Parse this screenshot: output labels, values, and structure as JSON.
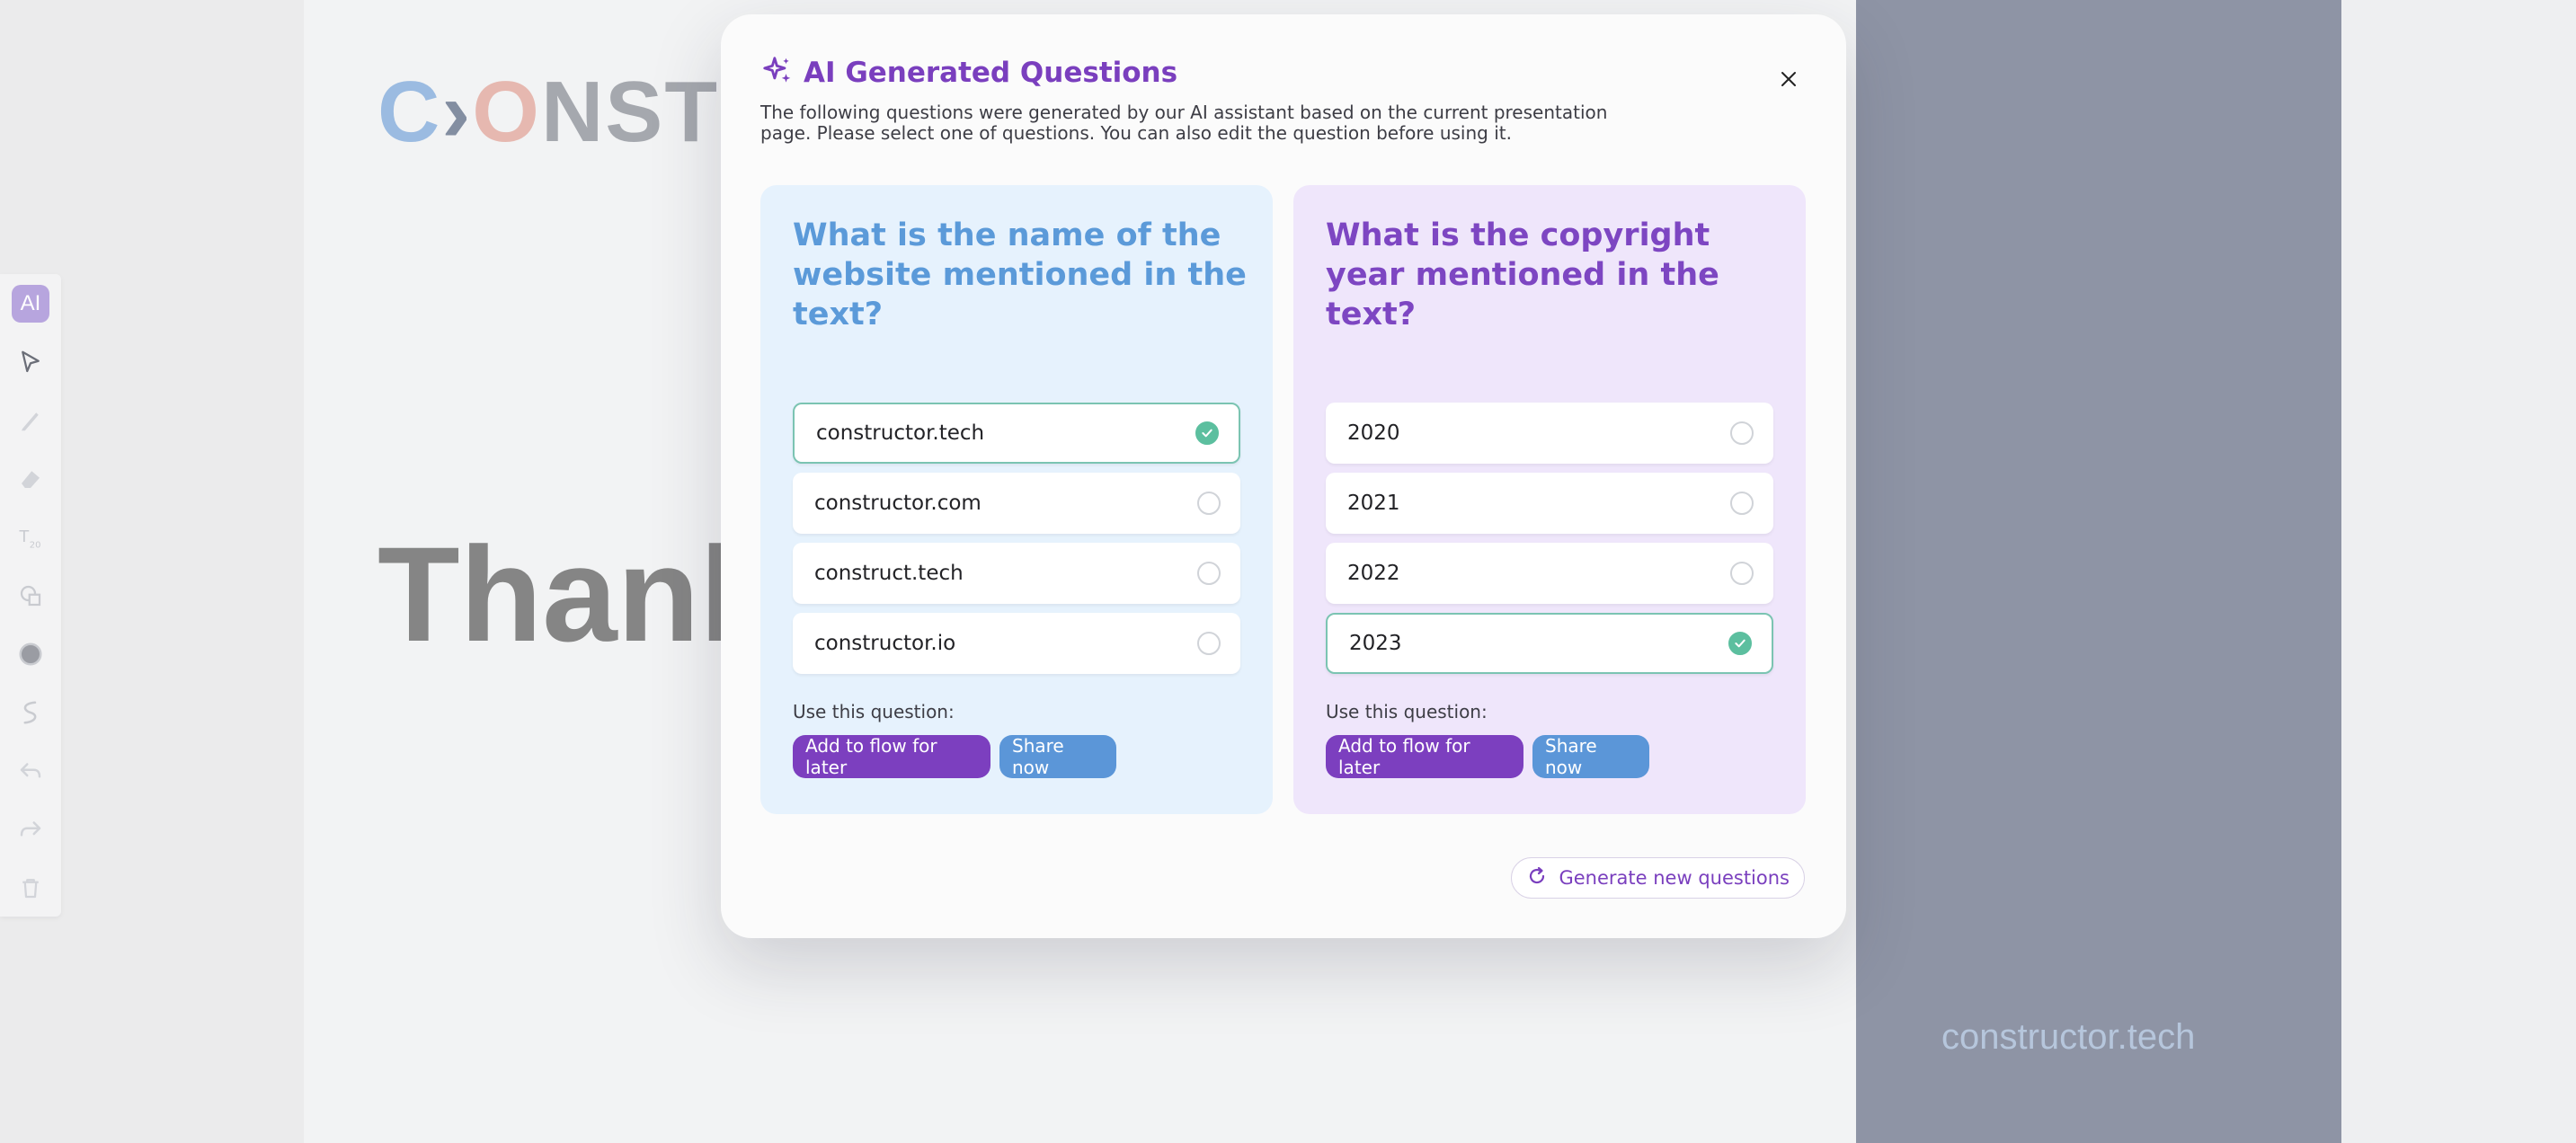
{
  "slide": {
    "logo": {
      "c": "C",
      "arrow": "›",
      "o": "O",
      "rest": "NST"
    },
    "heading": "Thank",
    "footer_text": "constructor.tech"
  },
  "toolbar": {
    "ai_label": "AI",
    "icons": [
      "cursor-icon",
      "pen-icon",
      "eraser-icon",
      "text-size-icon",
      "shapes-icon",
      "color-icon",
      "curve-icon",
      "undo-icon",
      "redo-icon",
      "trash-icon"
    ]
  },
  "dialog": {
    "title": "AI Generated Questions",
    "description": "The following questions were generated by our AI assistant based on the current presentation page. Please select one of questions. You can also edit the question before using it.",
    "generate_label": "Generate new questions",
    "use_label": "Use this question:",
    "add_flow_label": "Add to flow for later",
    "share_label": "Share now",
    "questions": [
      {
        "title": "What is the name of the website mentioned in the text?",
        "options": [
          {
            "label": "constructor.tech",
            "selected": true
          },
          {
            "label": "constructor.com",
            "selected": false
          },
          {
            "label": "construct.tech",
            "selected": false
          },
          {
            "label": "constructor.io",
            "selected": false
          }
        ]
      },
      {
        "title": "What is the copyright year mentioned in the text?",
        "options": [
          {
            "label": "2020",
            "selected": false
          },
          {
            "label": "2021",
            "selected": false
          },
          {
            "label": "2022",
            "selected": false
          },
          {
            "label": "2023",
            "selected": true
          }
        ]
      }
    ]
  },
  "colors": {
    "accent_purple": "#7a3fbe",
    "accent_blue": "#5b96d8",
    "check_green": "#5cbf9f"
  }
}
